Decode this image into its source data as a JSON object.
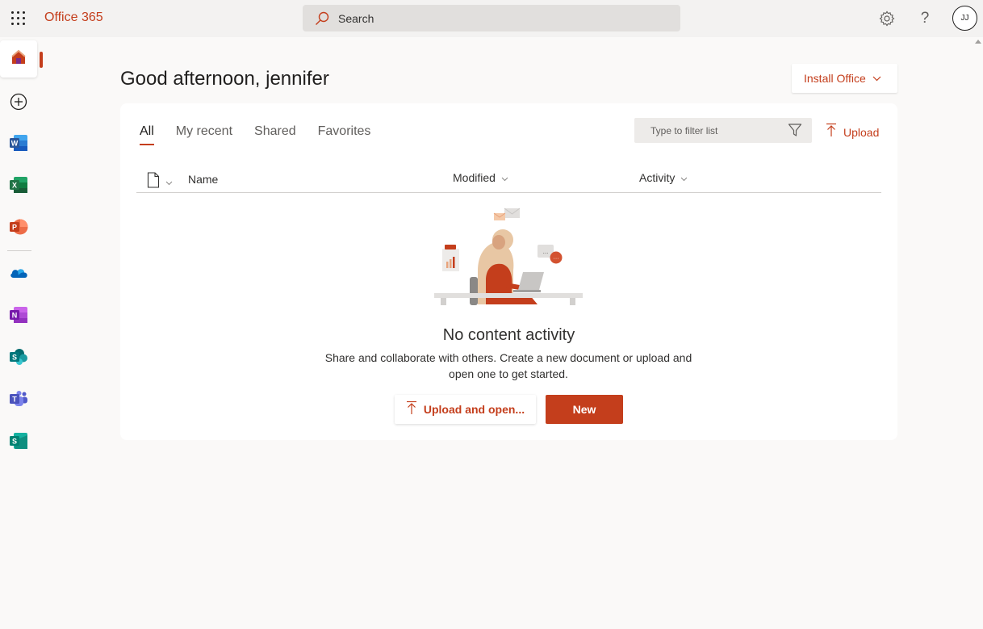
{
  "header": {
    "app_name": "Office 365",
    "search_placeholder": "Search",
    "avatar_initials": "JJ",
    "icons": [
      "app-launcher-icon",
      "search-icon",
      "gear-icon",
      "help-icon"
    ]
  },
  "rail": {
    "items": [
      {
        "name": "home",
        "icon": "home-icon",
        "active": true
      },
      {
        "name": "create",
        "icon": "plus-circle-icon"
      },
      {
        "name": "word",
        "icon": "word-icon",
        "letter": "W",
        "color": "#2b579a"
      },
      {
        "name": "excel",
        "icon": "excel-icon",
        "letter": "X",
        "color": "#217346"
      },
      {
        "name": "powerpoint",
        "icon": "powerpoint-icon",
        "letter": "P",
        "color": "#c43e1c"
      },
      {
        "name": "onedrive",
        "icon": "onedrive-icon",
        "color": "#0364b8"
      },
      {
        "name": "onenote",
        "icon": "onenote-icon",
        "letter": "N",
        "color": "#7719aa"
      },
      {
        "name": "sharepoint",
        "icon": "sharepoint-icon",
        "letter": "S",
        "color": "#036c70"
      },
      {
        "name": "teams",
        "icon": "teams-icon",
        "letter": "T",
        "color": "#4b53bc"
      },
      {
        "name": "sway",
        "icon": "sway-icon",
        "letter": "S",
        "color": "#008272"
      }
    ]
  },
  "main": {
    "greeting": "Good afternoon, jennifer",
    "install_label": "Install Office",
    "tabs": [
      {
        "label": "All",
        "active": true
      },
      {
        "label": "My recent"
      },
      {
        "label": "Shared"
      },
      {
        "label": "Favorites"
      }
    ],
    "filter_placeholder": "Type to filter list",
    "upload_label": "Upload",
    "columns": {
      "name": "Name",
      "modified": "Modified",
      "activity": "Activity"
    },
    "empty_title": "No content activity",
    "empty_desc_line1": "Share and collaborate with others. Create a new document or upload and",
    "empty_desc_line2": "open one to get started.",
    "upload_open_label": "Upload and open...",
    "new_label": "New"
  },
  "colors": {
    "accent": "#c43e1c",
    "background": "#faf9f8",
    "topbar": "#f3f2f1"
  }
}
